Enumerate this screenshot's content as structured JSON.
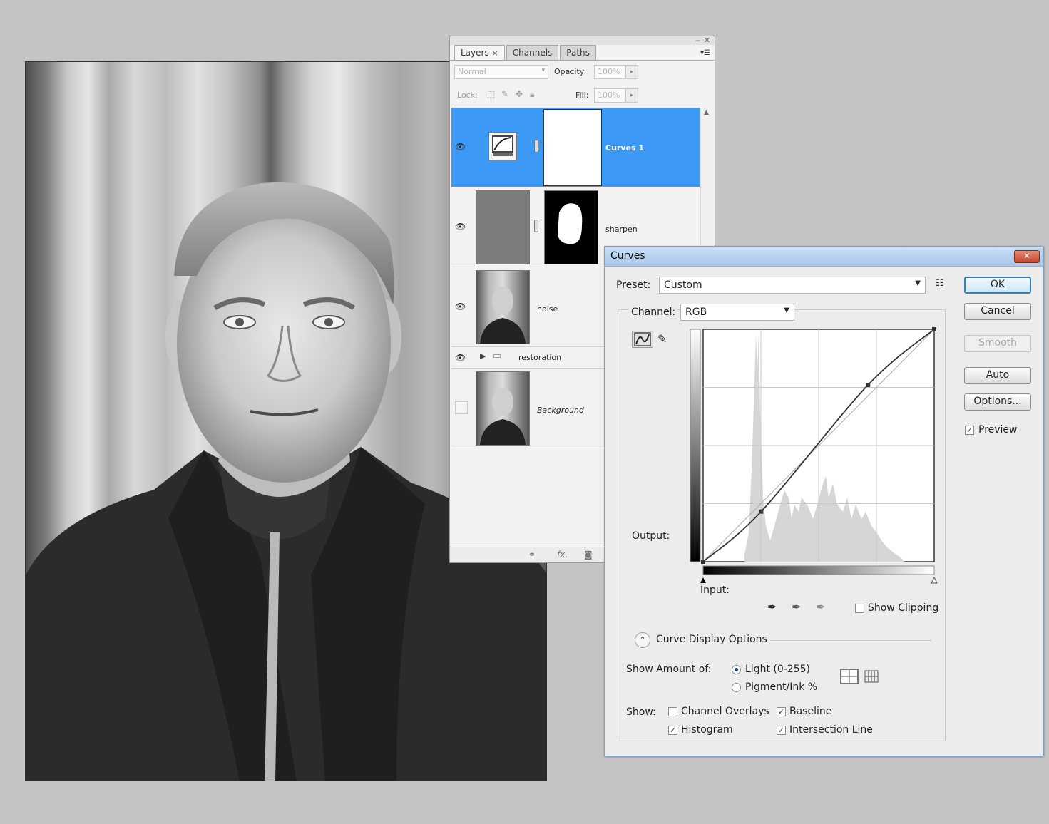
{
  "photo": {
    "description_icon": "portrait-photo"
  },
  "layers_panel": {
    "tabs": [
      {
        "label": "Layers",
        "close": "×",
        "active": true
      },
      {
        "label": "Channels",
        "active": false
      },
      {
        "label": "Paths",
        "active": false
      }
    ],
    "blend_mode": "Normal",
    "opacity_label": "Opacity:",
    "opacity_value": "100%",
    "lock_label": "Lock:",
    "fill_label": "Fill:",
    "fill_value": "100%",
    "layers": [
      {
        "name": "Curves 1",
        "selected": true,
        "visible": true
      },
      {
        "name": "sharpen",
        "selected": false,
        "visible": true
      },
      {
        "name": "noise",
        "selected": false,
        "visible": true
      },
      {
        "name": "restoration",
        "group": true,
        "visible": true
      },
      {
        "name": "Background",
        "italic": true,
        "visible": false
      }
    ]
  },
  "curves_dialog": {
    "title": "Curves",
    "preset_label": "Preset:",
    "preset_value": "Custom",
    "channel_label": "Channel:",
    "channel_value": "RGB",
    "output_label": "Output:",
    "input_label": "Input:",
    "show_clipping_label": "Show Clipping",
    "curve_display_options_label": "Curve Display Options",
    "show_amount_label": "Show Amount of:",
    "light_label": "Light  (0-255)",
    "pigment_label": "Pigment/Ink %",
    "show_label": "Show:",
    "channel_overlays_label": "Channel Overlays",
    "baseline_label": "Baseline",
    "histogram_label": "Histogram",
    "intersection_line_label": "Intersection Line",
    "buttons": {
      "ok": "OK",
      "cancel": "Cancel",
      "smooth": "Smooth",
      "auto": "Auto",
      "options": "Options..."
    },
    "preview_label": "Preview",
    "state": {
      "preview": true,
      "show_clipping": false,
      "channel_overlays": false,
      "baseline": true,
      "histogram": true,
      "intersection_line": true,
      "show_amount": "light"
    },
    "curve_points": [
      [
        0,
        0
      ],
      [
        64,
        55
      ],
      [
        182,
        194
      ],
      [
        255,
        255
      ]
    ]
  }
}
